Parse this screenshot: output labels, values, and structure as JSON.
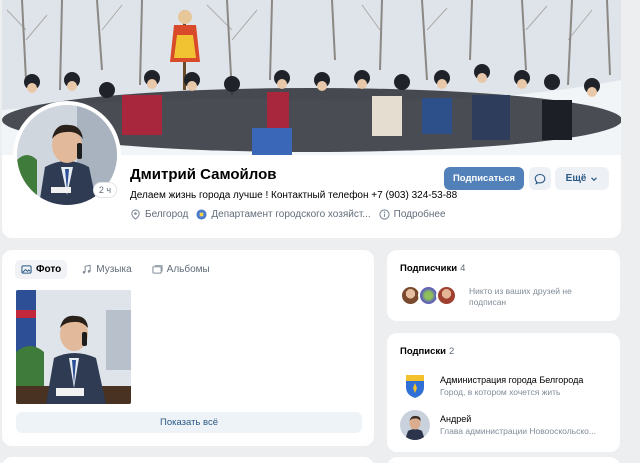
{
  "profile": {
    "name": "Дмитрий Самойлов",
    "status": "Делаем жизнь города лучше ! Контактный телефон +7 (903) 324-53-88",
    "avatar_badge": "2 ч",
    "city": "Белгород",
    "workplace": "Департамент городского хозяйст...",
    "details_label": "Подробнее",
    "subscribe_label": "Подписаться",
    "more_label": "Ещё"
  },
  "photos": {
    "tabs": [
      {
        "label": "Фото",
        "icon": "photo-icon",
        "active": true
      },
      {
        "label": "Музыка",
        "icon": "music-icon",
        "active": false
      },
      {
        "label": "Альбомы",
        "icon": "album-icon",
        "active": false
      }
    ],
    "show_all_label": "Показать всё"
  },
  "subscribers": {
    "title": "Подписчики",
    "count": "4",
    "note": "Никто из ваших друзей не подписан"
  },
  "subscriptions": {
    "title": "Подписки",
    "count": "2",
    "items": [
      {
        "title": "Администрация города Белгорода",
        "desc": "Город, в котором хочется жить"
      },
      {
        "title": "Андрей",
        "desc": "Глава администрации Новооскольско..."
      }
    ]
  },
  "colors": {
    "accent": "#5181b8",
    "link": "#2a5885",
    "background": "#edeef0"
  }
}
